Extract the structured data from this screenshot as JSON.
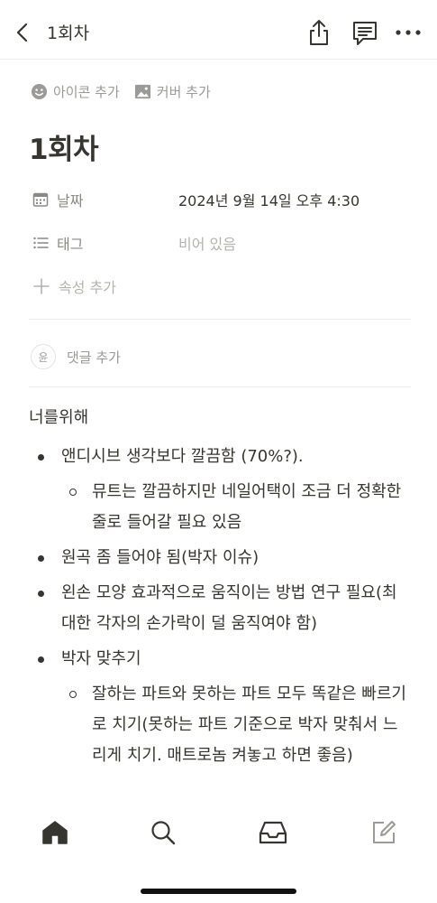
{
  "header": {
    "title": "1회차"
  },
  "page_actions": {
    "add_icon": "아이콘 추가",
    "add_cover": "커버 추가"
  },
  "page": {
    "title": "1회차"
  },
  "properties": {
    "date": {
      "name": "날짜",
      "value": "2024년 9월 14일 오후 4:30",
      "icon": "calendar-icon"
    },
    "tags": {
      "name": "태그",
      "value": "비어 있음",
      "icon": "list-icon"
    },
    "add_property": "속성 추가"
  },
  "comments": {
    "avatar_initial": "윤",
    "add_comment": "댓글 추가"
  },
  "content": {
    "heading": "너를위해",
    "items": [
      {
        "text": "앤디시브 생각보다 깔끔함 (70%?).",
        "children": [
          "뮤트는 깔끔하지만 네일어택이 조금 더 정확한 줄로 들어갈 필요 있음"
        ]
      },
      {
        "text": "원곡 좀 들어야 됨(박자 이슈)",
        "children": []
      },
      {
        "text": "왼손 모양 효과적으로 움직이는 방법 연구 필요(최대한 각자의 손가락이 덜 움직여야 함)",
        "children": []
      },
      {
        "text": "박자 맞추기",
        "children": [
          "잘하는 파트와 못하는 파트 모두 똑같은 빠르기로 치기(못하는 파트 기준으로 박자 맞춰서 느리게 치기. 매트로놈 켜놓고 하면 좋음)"
        ]
      }
    ]
  },
  "bottom_nav": {
    "items": [
      "home-icon",
      "search-icon",
      "inbox-icon",
      "compose-icon"
    ]
  }
}
